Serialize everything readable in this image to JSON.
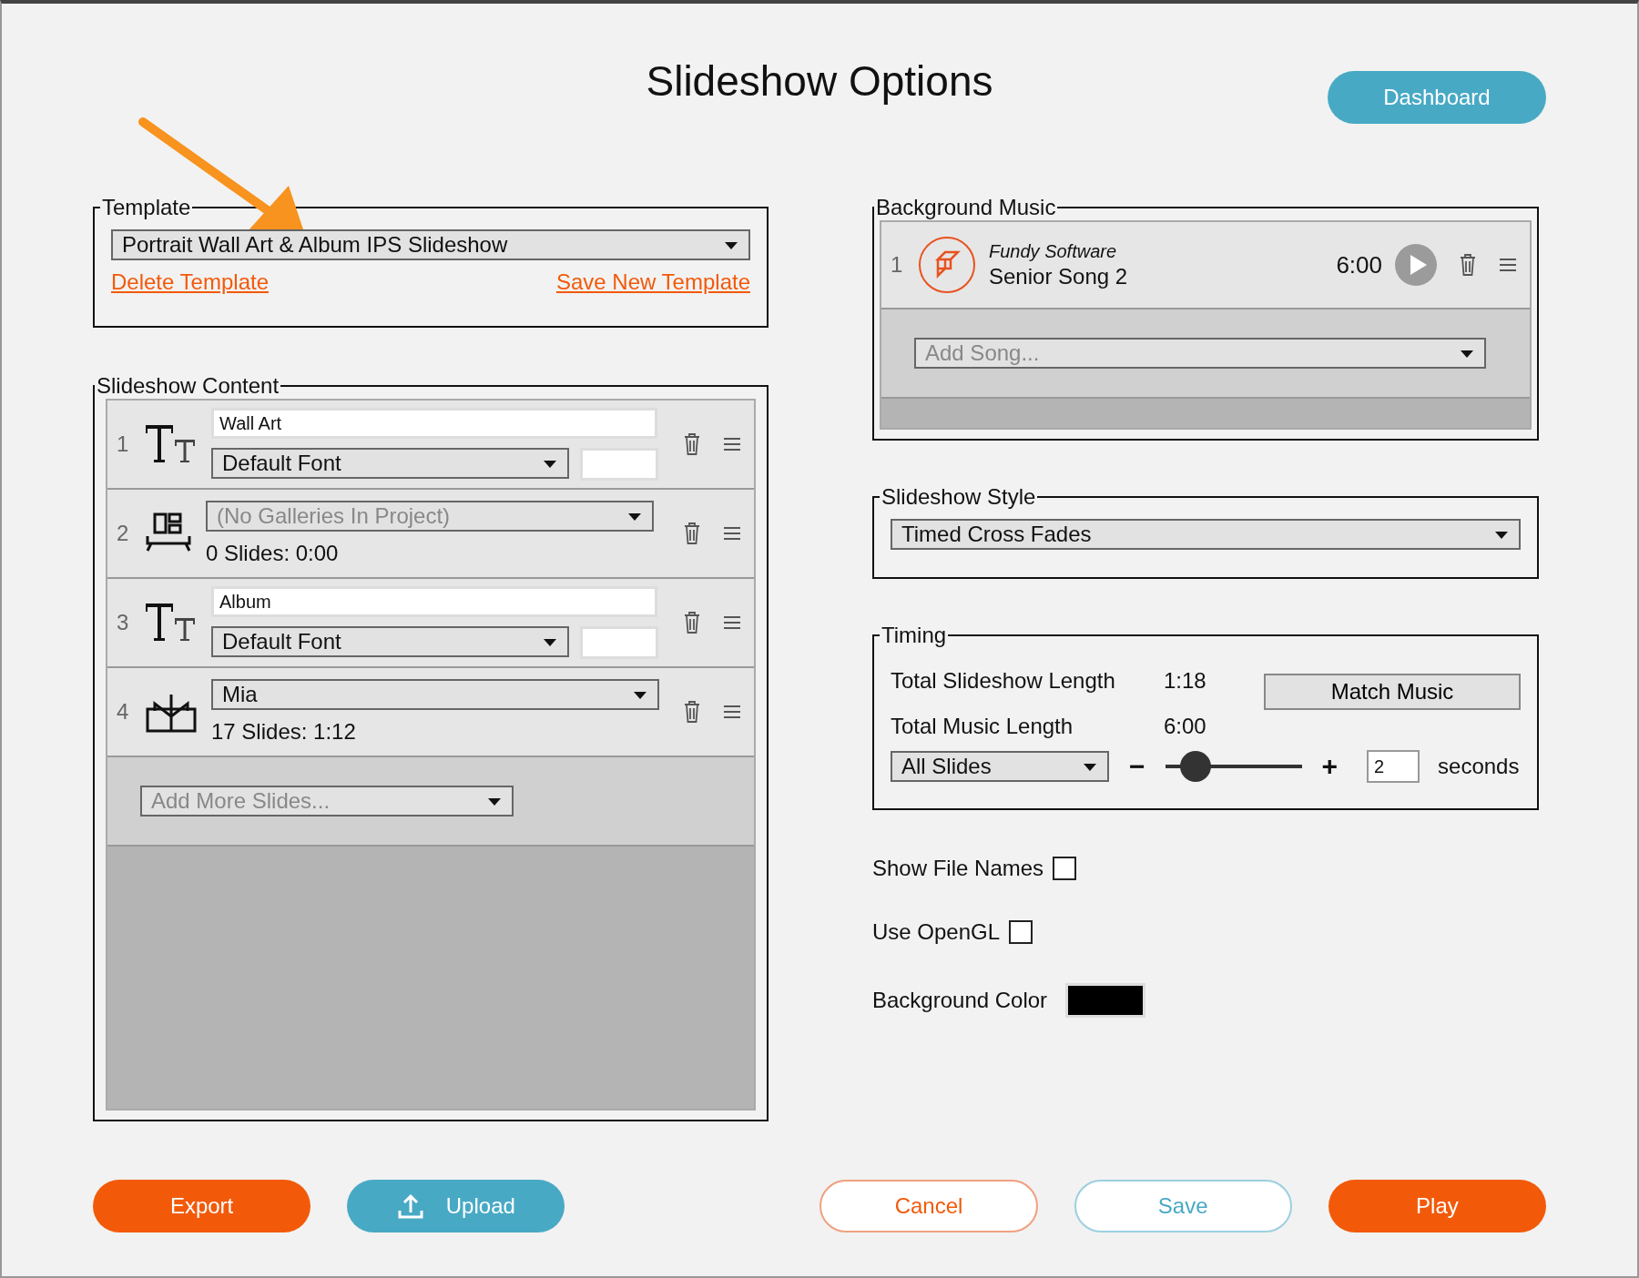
{
  "title": "Slideshow Options",
  "dashboard_button": "Dashboard",
  "template": {
    "legend": "Template",
    "value": "Portrait Wall Art & Album IPS Slideshow",
    "delete_link": "Delete Template",
    "save_link": "Save New Template"
  },
  "content": {
    "legend": "Slideshow Content",
    "items": [
      {
        "kind": "text",
        "number": "1",
        "value": "Wall Art",
        "font": "Default Font"
      },
      {
        "kind": "gallery",
        "number": "2",
        "value": "(No Galleries In Project)",
        "disabled": true,
        "summary": "0 Slides: 0:00"
      },
      {
        "kind": "text",
        "number": "3",
        "value": "Album",
        "font": "Default Font"
      },
      {
        "kind": "album",
        "number": "4",
        "value": "Mia",
        "disabled": false,
        "summary": "17 Slides: 1:12"
      }
    ],
    "add_placeholder": "Add More Slides..."
  },
  "music": {
    "legend": "Background Music",
    "songs": [
      {
        "number": "1",
        "artist": "Fundy Software",
        "title": "Senior Song 2",
        "length": "6:00"
      }
    ],
    "add_placeholder": "Add Song..."
  },
  "style": {
    "legend": "Slideshow Style",
    "value": "Timed Cross Fades"
  },
  "timing": {
    "legend": "Timing",
    "rows": [
      {
        "label": "Total Slideshow Length",
        "value": "1:18"
      },
      {
        "label": "Total Music Length",
        "value": "6:00"
      }
    ],
    "match_button": "Match Music",
    "scope": "All Slides",
    "minus": "−",
    "plus": "+",
    "level": 0.22,
    "seconds_value": "2",
    "unit": "seconds"
  },
  "options": [
    {
      "label": "Show File Names",
      "checked": false
    },
    {
      "label": "Use OpenGL",
      "checked": false
    }
  ],
  "background_color": {
    "label": "Background Color",
    "color": "#000000"
  },
  "buttons": [
    {
      "label": "Export",
      "kind": "primary"
    },
    {
      "label": "Upload",
      "kind": "upload"
    },
    {
      "label": "Cancel",
      "kind": "outline-orange"
    },
    {
      "label": "Save",
      "kind": "outline-blue"
    },
    {
      "label": "Play",
      "kind": "primary"
    }
  ]
}
